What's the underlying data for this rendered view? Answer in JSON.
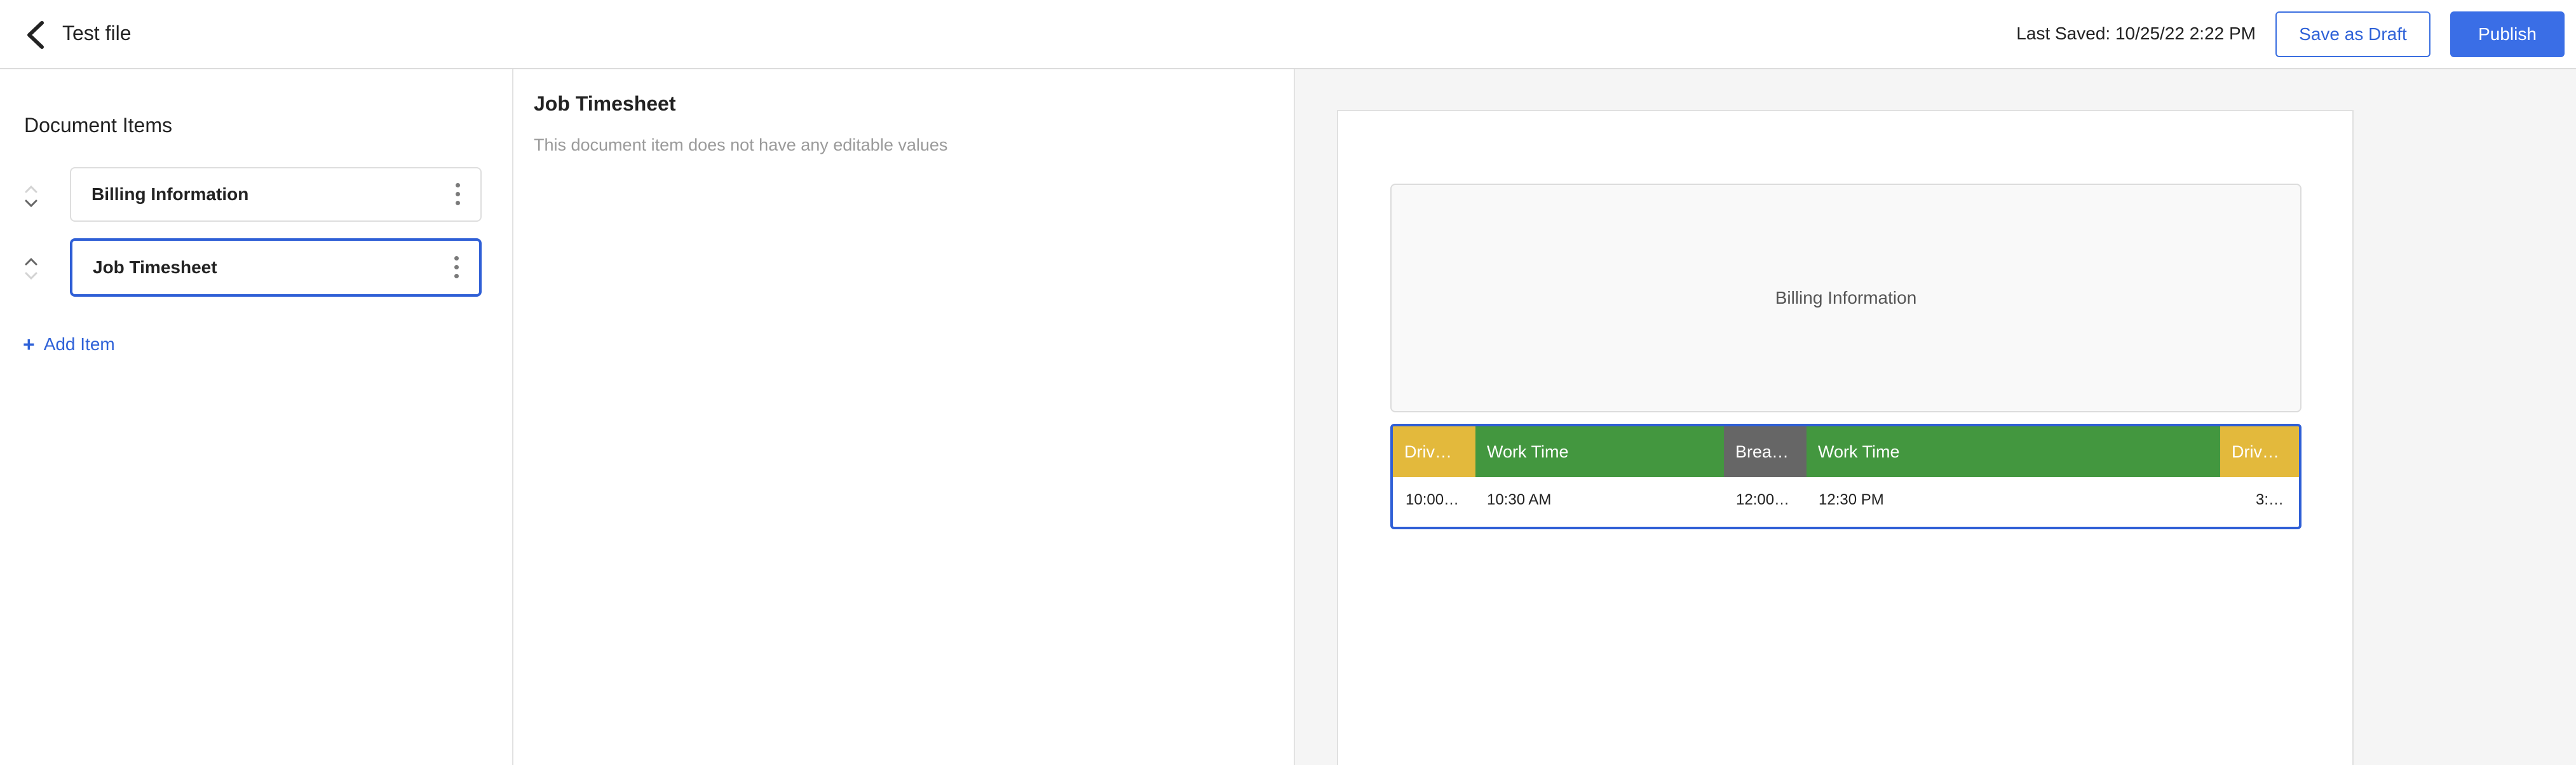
{
  "header": {
    "title": "Test file",
    "last_saved": "Last Saved: 10/25/22 2:22 PM",
    "save_draft_label": "Save as Draft",
    "publish_label": "Publish",
    "back_icon": "chevron-left-icon"
  },
  "sidebar": {
    "heading": "Document Items",
    "items": [
      {
        "label": "Billing Information",
        "selected": false,
        "can_move_up": false,
        "can_move_down": true
      },
      {
        "label": "Job Timesheet",
        "selected": true,
        "can_move_up": true,
        "can_move_down": false
      }
    ],
    "add_item_label": "Add Item"
  },
  "editor": {
    "title": "Job Timesheet",
    "note": "This document item does not have any editable values"
  },
  "preview": {
    "billing_label": "Billing Information",
    "timesheet": {
      "segments": [
        {
          "label": "Driv…",
          "color": "#e3b93c"
        },
        {
          "label": "Work Time",
          "color": "#43973f"
        },
        {
          "label": "Brea…",
          "color": "#666666"
        },
        {
          "label": "Work Time",
          "color": "#43973f"
        },
        {
          "label": "Driv…",
          "color": "#e3b93c"
        }
      ],
      "times": [
        "10:00…",
        "10:30 AM",
        "12:00…",
        "12:30 PM",
        "3:…"
      ]
    }
  },
  "colors": {
    "accent": "#3a6ee6",
    "drive": "#e3b93c",
    "work": "#43973f",
    "break": "#666666"
  }
}
